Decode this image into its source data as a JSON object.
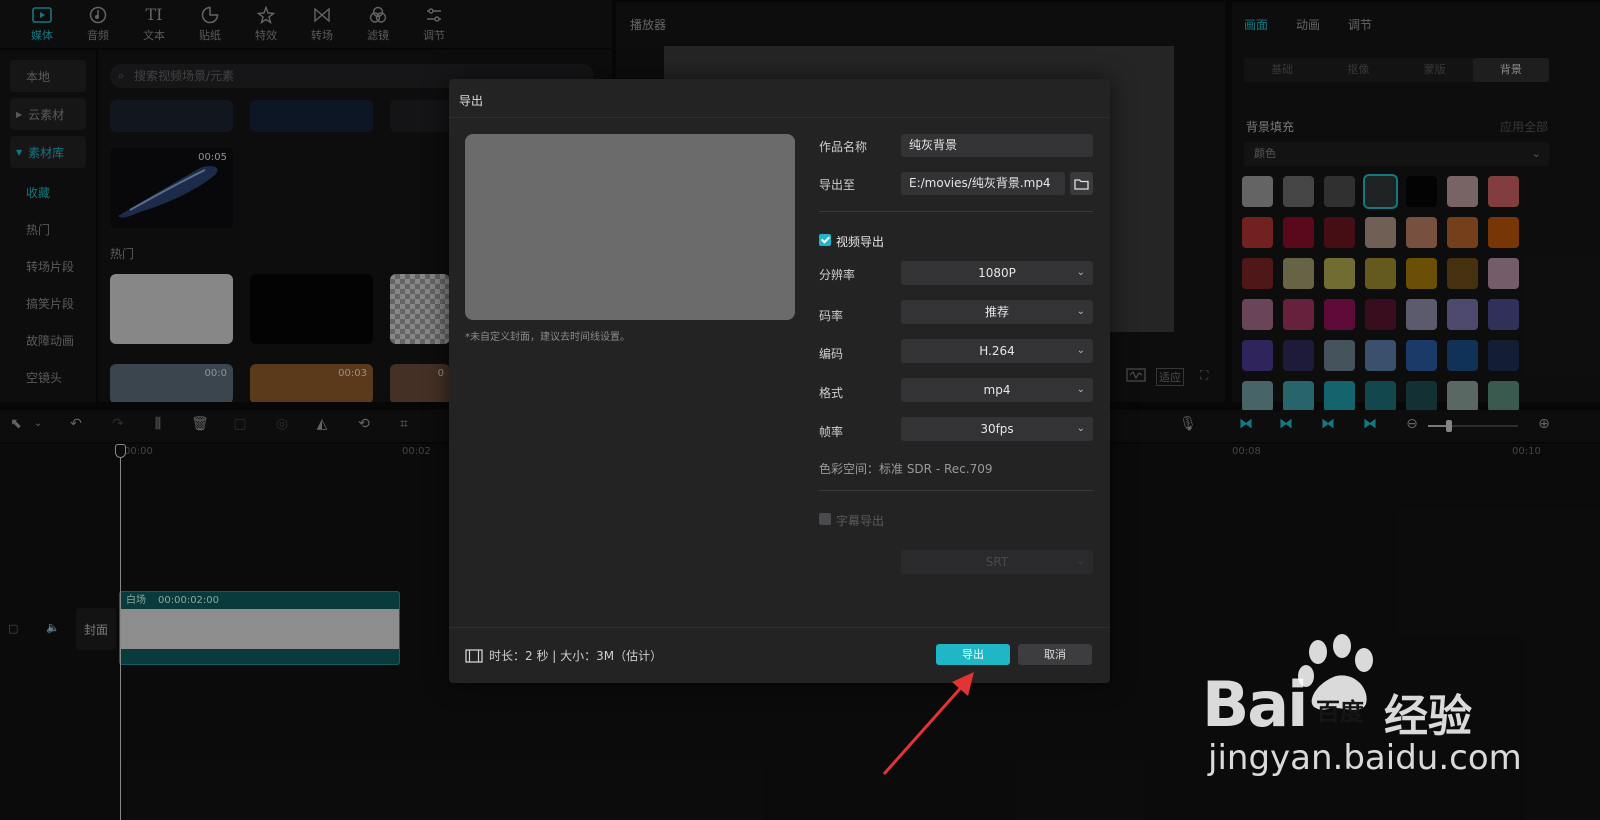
{
  "nav": [
    {
      "label": "媒体",
      "icon": "media-icon",
      "active": true
    },
    {
      "label": "音频",
      "icon": "audio-icon"
    },
    {
      "label": "文本",
      "icon": "text-icon",
      "glyph": "TI"
    },
    {
      "label": "贴纸",
      "icon": "sticker-icon"
    },
    {
      "label": "特效",
      "icon": "effects-icon"
    },
    {
      "label": "转场",
      "icon": "transition-icon"
    },
    {
      "label": "滤镜",
      "icon": "filter-icon"
    },
    {
      "label": "调节",
      "icon": "adjust-icon"
    }
  ],
  "sidebar": {
    "local": "本地",
    "cloud": "云素材",
    "library": "素材库",
    "favorites": "收藏",
    "hot": "热门",
    "transition_clips": "转场片段",
    "funny_clips": "搞笑片段",
    "glitch_anim": "故障动画",
    "empty_shot": "空镜头"
  },
  "library": {
    "search_placeholder": "搜索视频场景/元素",
    "hot_label": "热门",
    "durations": [
      "00:05",
      "00:0",
      "00:03",
      "0"
    ]
  },
  "player": {
    "title": "播放器",
    "fit": "适应"
  },
  "right_panel": {
    "tabs": [
      "画面",
      "动画",
      "调节"
    ],
    "subtabs": [
      "基础",
      "抠像",
      "蒙版",
      "背景"
    ],
    "bg_fill": "背景填充",
    "apply_all": "应用全部",
    "color_select": "颜色",
    "swatches": [
      "#9a9a9a",
      "#6a6a6a",
      "#4a4a4a",
      "#2e3536",
      "#060606",
      "#b89a9c",
      "#c5625f",
      "#b03433",
      "#8a0f2a",
      "#6b1420",
      "#ab9283",
      "#b77b63",
      "#b5622b",
      "#b8530c",
      "#7a2424",
      "#9e9a6a",
      "#aea64c",
      "#9a8a2e",
      "#a57a0a",
      "#6a4a1a",
      "#b38ea2",
      "#a36a88",
      "#a0345e",
      "#93125a",
      "#5a142e",
      "#8e8ca8",
      "#7670a6",
      "#4a4a8a",
      "#4a3890",
      "#2e2a5a",
      "#6a8090",
      "#5a7ca8",
      "#2a5aa0",
      "#1a4e86",
      "#1e2e52",
      "#6e9aa0",
      "#3e9aa6",
      "#1e9aa6",
      "#1e6e78",
      "#1e4a52",
      "#8aa09a",
      "#5a8a7a"
    ]
  },
  "timeline": {
    "ruler": [
      "00:00",
      "00:02",
      "00:08",
      "00:10"
    ],
    "cover": "封面",
    "clip_name": "白场",
    "clip_time": "00:00:02:00"
  },
  "modal": {
    "title": "导出",
    "hint": "*未自定义封面，建议去时间线设置。",
    "name_label": "作品名称",
    "name_value": "纯灰背景",
    "export_to_label": "导出至",
    "export_to_value": "E:/movies/纯灰背景.mp4",
    "video_export_label": "视频导出",
    "resolution_label": "分辨率",
    "resolution_value": "1080P",
    "bitrate_label": "码率",
    "bitrate_value": "推荐",
    "codec_label": "编码",
    "codec_value": "H.264",
    "format_label": "格式",
    "format_value": "mp4",
    "fps_label": "帧率",
    "fps_value": "30fps",
    "colorspace": "色彩空间：标准 SDR - Rec.709",
    "subtitle_export_label": "字幕导出",
    "subtitle_format_value": "SRT",
    "footer_info": "时长：2 秒 | 大小：3M（估计）",
    "export_button": "导出",
    "cancel_button": "取消"
  },
  "watermark": {
    "brand": "Bai",
    "brand2": "百度",
    "suffix": "经验",
    "url": "jingyan.baidu.com"
  }
}
